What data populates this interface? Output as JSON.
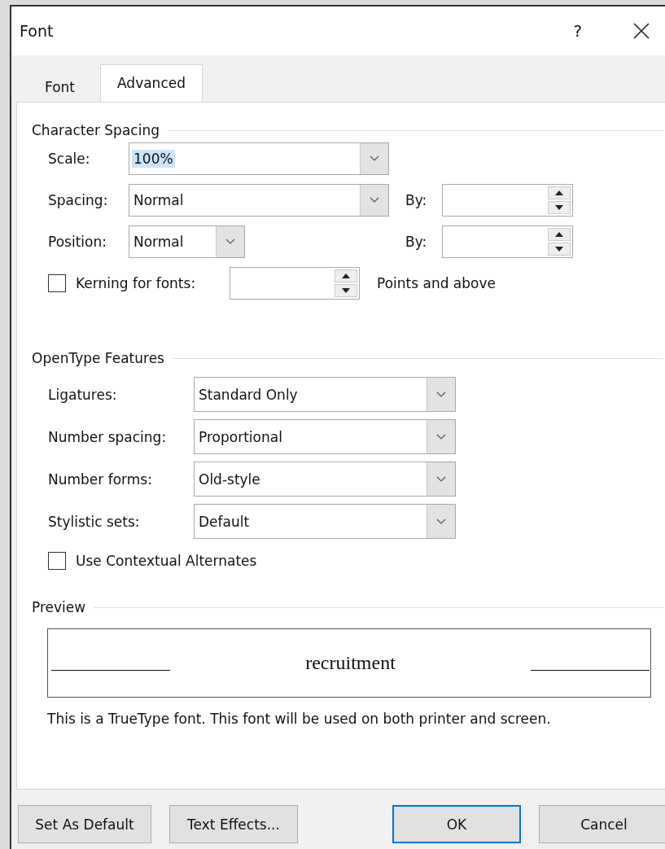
{
  "window": {
    "title": "Font",
    "help": "?"
  },
  "tabs": [
    {
      "label": "Font",
      "selected": false
    },
    {
      "label": "Advanced",
      "selected": true
    }
  ],
  "character_spacing": {
    "title": "Character Spacing",
    "fields": [
      {
        "label": "Scale:",
        "value": "100%",
        "value_selected": true
      },
      {
        "label": "Spacing:",
        "value": "Normal",
        "value_selected": false,
        "by": "By:"
      },
      {
        "label": "Position:",
        "value": "Normal",
        "value_selected": false,
        "by": "By:"
      }
    ],
    "kerning": {
      "label": "Kerning for fonts:",
      "checked": false,
      "unit": "Points and above"
    }
  },
  "opentype_features": {
    "title": "OpenType Features",
    "fields": [
      {
        "label": "Ligatures:",
        "value": "Standard Only"
      },
      {
        "label": "Number spacing:",
        "value": "Proportional"
      },
      {
        "label": "Number forms:",
        "value": "Old-style"
      },
      {
        "label": "Stylistic sets:",
        "value": "Default"
      }
    ],
    "contextual_alternates": {
      "label": "Use Contextual Alternates",
      "checked": false
    }
  },
  "preview": {
    "title": "Preview",
    "sample": "recruitment",
    "note": "This is a TrueType font. This font will be used on both printer and screen."
  },
  "buttons": [
    {
      "label": "Set As Default",
      "default": false
    },
    {
      "label": "Text Effects...",
      "default": false
    },
    {
      "label": "OK",
      "default": true
    },
    {
      "label": "Cancel",
      "default": false
    }
  ]
}
